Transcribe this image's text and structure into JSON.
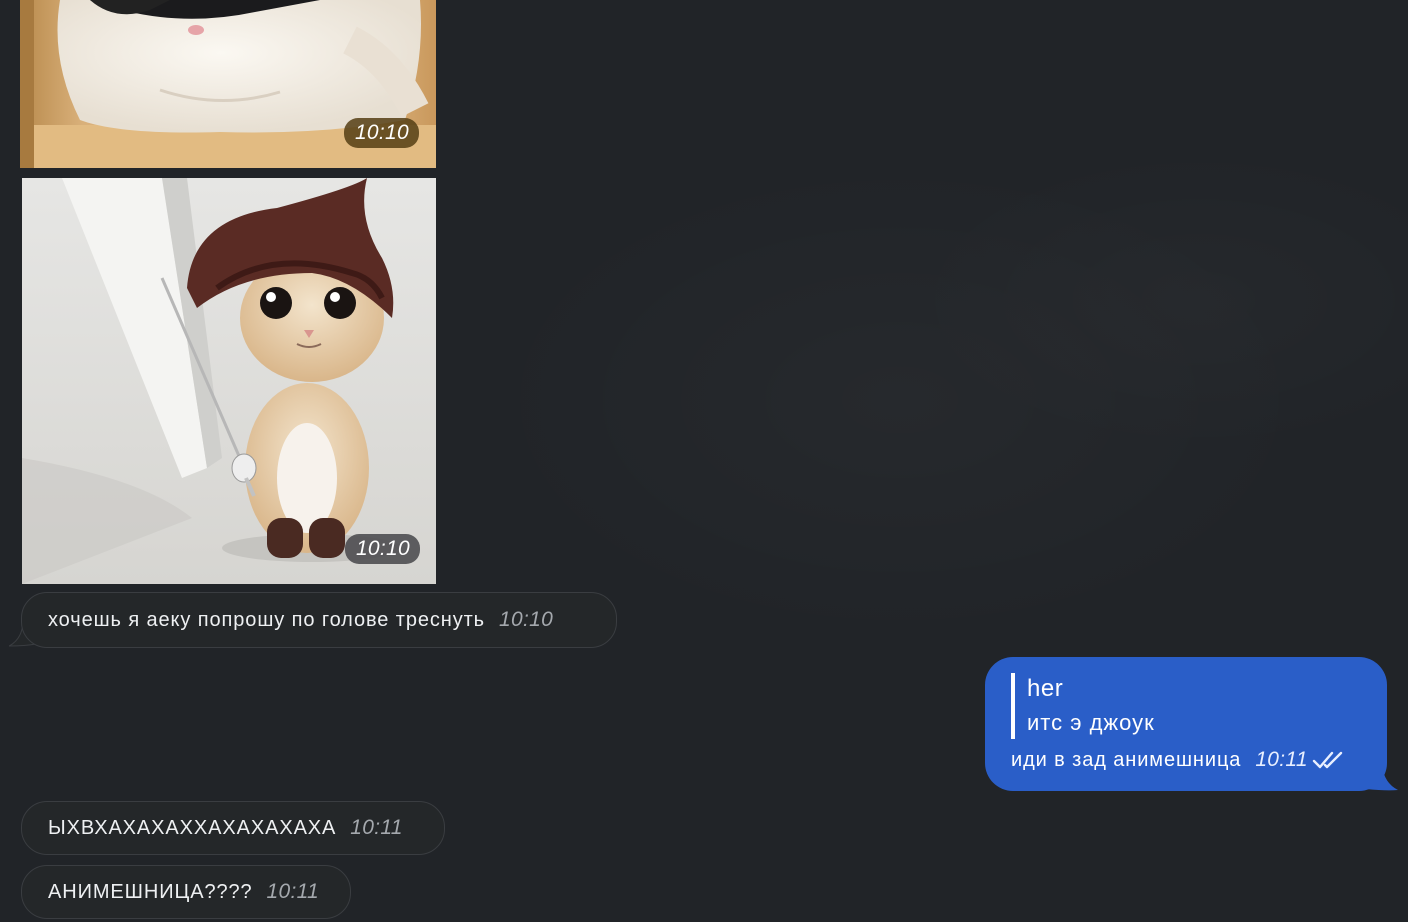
{
  "colors": {
    "background": "#212428",
    "incoming_bubble": "#242729",
    "outgoing_bubble": "#2a5ec8",
    "time_muted": "#a4a8ad"
  },
  "messages": {
    "photo1": {
      "time": "10:10"
    },
    "photo2": {
      "time": "10:10"
    },
    "incoming1": {
      "text": "хочешь я аеку попрошу по голове треснуть",
      "time": "10:10"
    },
    "outgoing1": {
      "reply_author": "her",
      "reply_text": "итс э джоук",
      "text": "иди в зад анимешница",
      "time": "10:11",
      "status_icon": "double-check-icon"
    },
    "incoming2": {
      "text": "ЫХВХАХАХАХХАХАХАХАХА",
      "time": "10:11"
    },
    "incoming3": {
      "text": "АНИМЕШНИЦА????",
      "time": "10:11"
    }
  }
}
